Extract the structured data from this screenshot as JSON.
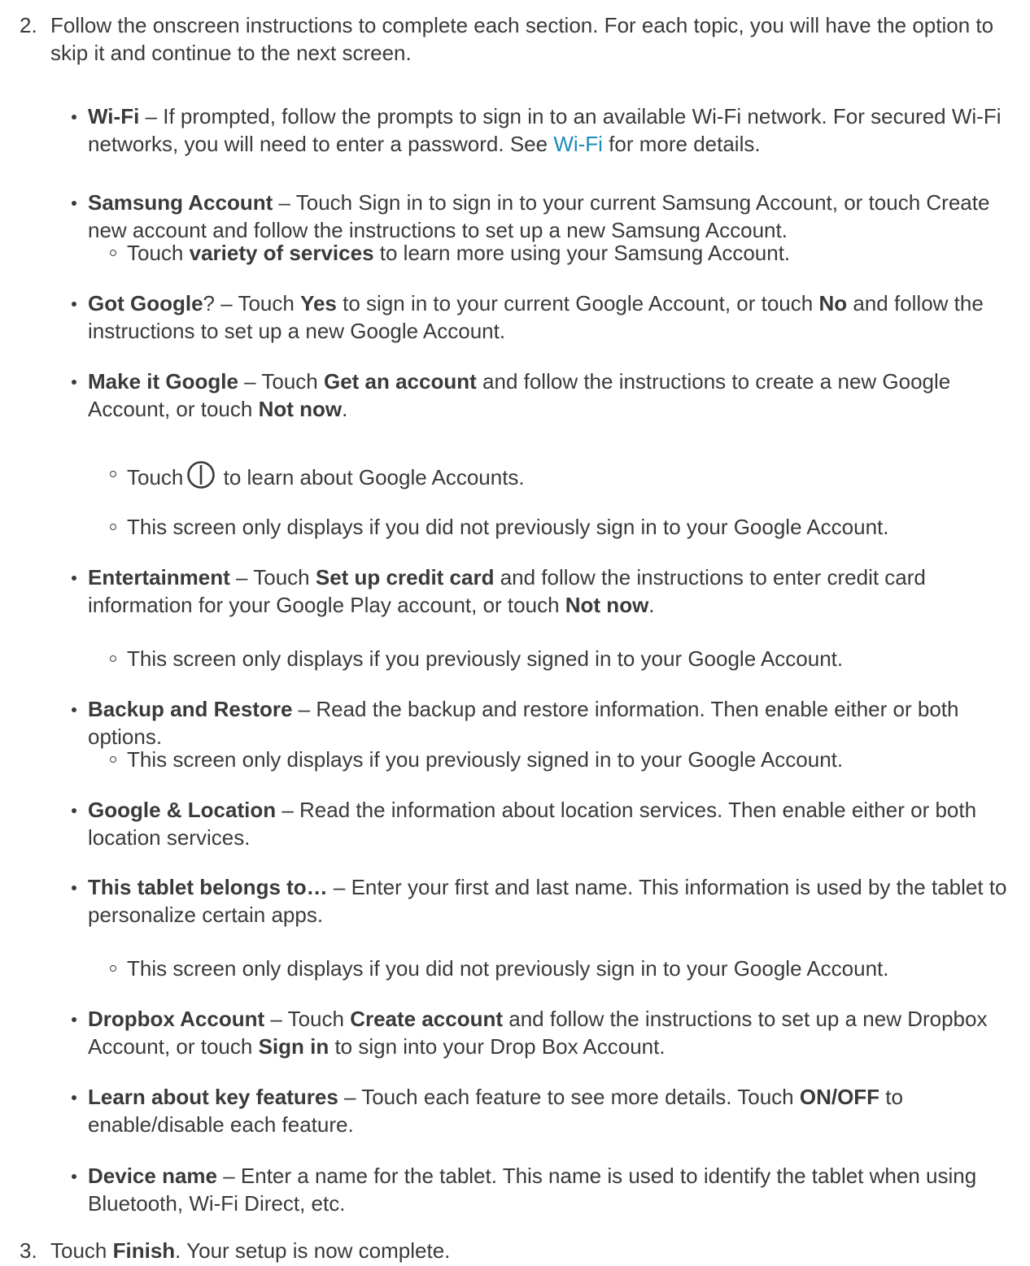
{
  "step2": {
    "number": "2.",
    "text": "Follow the onscreen instructions to complete each section. For each topic, you will have the option to skip it and continue to the next screen."
  },
  "wifi": {
    "title": "Wi-Fi",
    "text1": " – If prompted, follow the prompts to sign in to an available Wi-Fi network. For secured Wi-Fi networks, you will need to enter a password. See ",
    "link": "Wi-Fi",
    "text2": " for more details."
  },
  "samsung": {
    "title": "Samsung Account",
    "text": " – Touch Sign in to sign in to your current Samsung Account, or touch Create new account and follow the instructions to set up a new Samsung Account.",
    "sub_pre": "Touch ",
    "sub_bold": "variety of services",
    "sub_post": " to learn more using your Samsung Account."
  },
  "gotgoogle": {
    "title": "Got Google",
    "t1": "? – Touch ",
    "yes": "Yes",
    "t2": " to sign in to your current Google Account, or touch ",
    "no": "No",
    "t3": " and follow the instructions to set up a new Google Account."
  },
  "makeitgoogle": {
    "title": "Make it Google",
    "t1": " – Touch ",
    "get": "Get an account",
    "t2": " and follow the instructions to create a new Google Account, or touch ",
    "notnow": "Not now",
    "t3": ".",
    "sub1_pre": "Touch",
    "sub1_icon": "info-icon",
    "sub1_post": " to learn about Google Accounts.",
    "sub2": "This screen only displays if you did not previously sign in to your Google Account."
  },
  "entertainment": {
    "title": "Entertainment",
    "t1": " – Touch ",
    "setup": "Set up credit card",
    "t2": " and follow the instructions to enter credit card information for your Google Play account, or touch ",
    "notnow": "Not now",
    "t3": ".",
    "sub": "This screen only displays if you previously signed in to your Google Account."
  },
  "backup": {
    "title": "Backup and Restore",
    "text": " – Read the backup and restore information. Then enable either or both options.",
    "sub": "This screen only displays if you previously signed in to your Google Account."
  },
  "location": {
    "title": "Google & Location",
    "text": " – Read the information about location services. Then enable either or both location services."
  },
  "belongs": {
    "title": "This tablet belongs to…",
    "text": " – Enter your first and last name. This information is used by the tablet to personalize certain apps.",
    "sub": "This screen only displays if you did not previously sign in to your Google Account."
  },
  "dropbox": {
    "title": "Dropbox Account",
    "t1": " – Touch ",
    "create": "Create account",
    "t2": " and follow the instructions to set up a new Dropbox Account, or touch ",
    "signin": "Sign in",
    "t3": " to sign into your Drop Box Account."
  },
  "features": {
    "title": "Learn about key features",
    "t1": " – Touch each feature to see more details. Touch ",
    "onoff": "ON/OFF",
    "t2": " to enable/disable each feature."
  },
  "devicename": {
    "title": "Device name",
    "text": " – Enter a name for the tablet. This name is used to identify the tablet when using Bluetooth, Wi-Fi Direct, etc."
  },
  "step3": {
    "number": "3.",
    "t1": "Touch ",
    "finish": "Finish",
    "t2": ". Your setup is now complete."
  },
  "colors": {
    "text": "#3a3a3a",
    "link": "#1a8cb8"
  }
}
